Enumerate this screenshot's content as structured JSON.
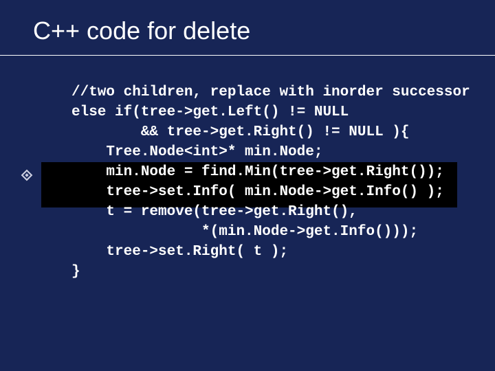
{
  "title": "C++ code for delete",
  "code": {
    "l1": "//two children, replace with inorder successor",
    "l2": "else if(tree->get.Left() != NULL",
    "l3": "        && tree->get.Right() != NULL ){",
    "l4": "    Tree.Node<int>* min.Node;",
    "l5": "    min.Node = find.Min(tree->get.Right());",
    "l6": "    tree->set.Info( min.Node->get.Info() );",
    "l7": "    t = remove(tree->get.Right(),",
    "l8": "               *(min.Node->get.Info()));",
    "l9": "    tree->set.Right( t );",
    "l10": "}"
  }
}
